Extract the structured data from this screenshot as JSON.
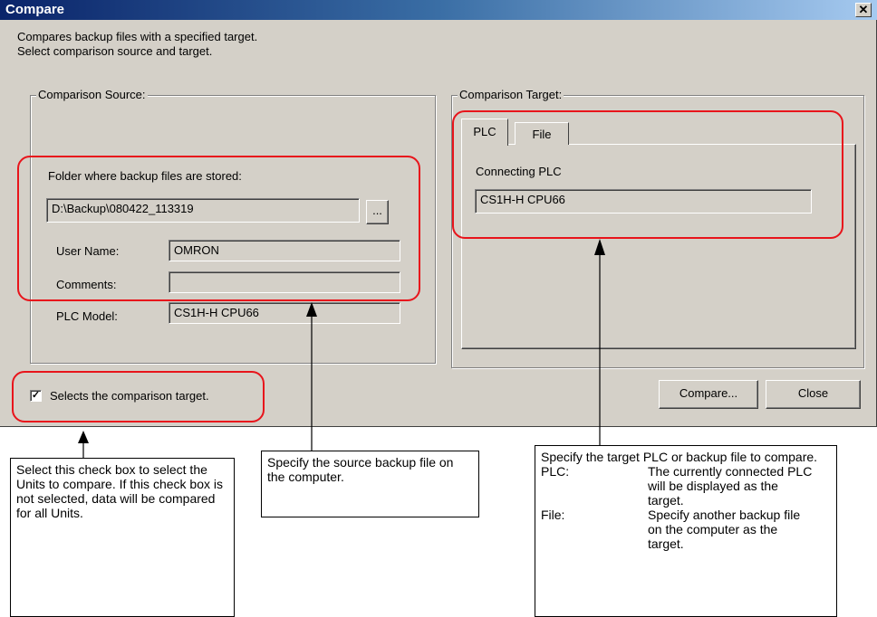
{
  "window": {
    "title": "Compare",
    "close_glyph": "✕"
  },
  "description": {
    "line1": "Compares backup files with a specified target.",
    "line2": "Select comparison source and target."
  },
  "source": {
    "group_label": "Comparison Source:",
    "folder_label": "Folder where backup files are stored:",
    "folder_value": "D:\\Backup\\080422_113319",
    "browse_label": "...",
    "user_name_label": "User Name:",
    "user_name_value": "OMRON",
    "comments_label": "Comments:",
    "comments_value": "",
    "plc_model_label": "PLC Model:",
    "plc_model_value": "CS1H-H CPU66"
  },
  "target": {
    "group_label": "Comparison Target:",
    "tabs": [
      "PLC",
      "File"
    ],
    "active_tab": "PLC",
    "connecting_label": "Connecting PLC",
    "connecting_value": "CS1H-H CPU66"
  },
  "select_checkbox": {
    "checked": true,
    "check_glyph": "✓",
    "label": "Selects the comparison target."
  },
  "buttons": {
    "compare": "Compare...",
    "close": "Close"
  },
  "callouts": {
    "checkbox_note": "Select this check box to select the Units to compare. If this check box is not selected, data will be compared for all Units.",
    "source_note": "Specify the source backup file on the computer.",
    "target_note": {
      "intro": "Specify the target PLC or backup file to compare.",
      "items": [
        {
          "term": "PLC:",
          "desc": "The currently connected PLC will be displayed as the target."
        },
        {
          "term": "File:",
          "desc": "Specify another backup file on the computer as the target."
        }
      ]
    }
  },
  "colors": {
    "highlight": "#e8141b",
    "dialog_bg": "#d4d0c8",
    "title_bar": "#0a246a"
  }
}
